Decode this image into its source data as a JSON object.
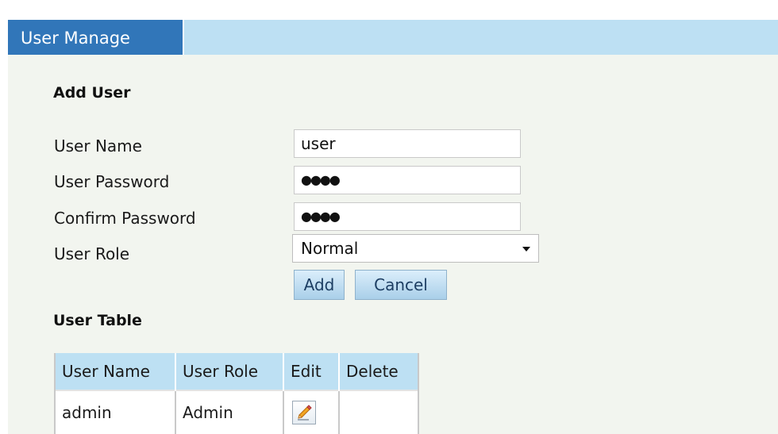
{
  "tab": {
    "label": "User Manage"
  },
  "add_user": {
    "heading": "Add User",
    "fields": {
      "user_name": {
        "label": "User Name",
        "value": "user"
      },
      "user_password": {
        "label": "User Password",
        "value": "●●●●"
      },
      "confirm_password": {
        "label": "Confirm Password",
        "value": "●●●●"
      },
      "user_role": {
        "label": "User Role",
        "value": "Normal"
      }
    },
    "buttons": {
      "add": "Add",
      "cancel": "Cancel"
    }
  },
  "user_table": {
    "heading": "User Table",
    "columns": [
      "User Name",
      "User Role",
      "Edit",
      "Delete"
    ],
    "rows": [
      {
        "user_name": "admin",
        "user_role": "Admin",
        "edit_icon": "edit-pencil-icon"
      }
    ]
  },
  "colors": {
    "tab_bg": "#3176b9",
    "header_bg": "#bde0f3",
    "panel_bg": "#f2f5ef"
  }
}
